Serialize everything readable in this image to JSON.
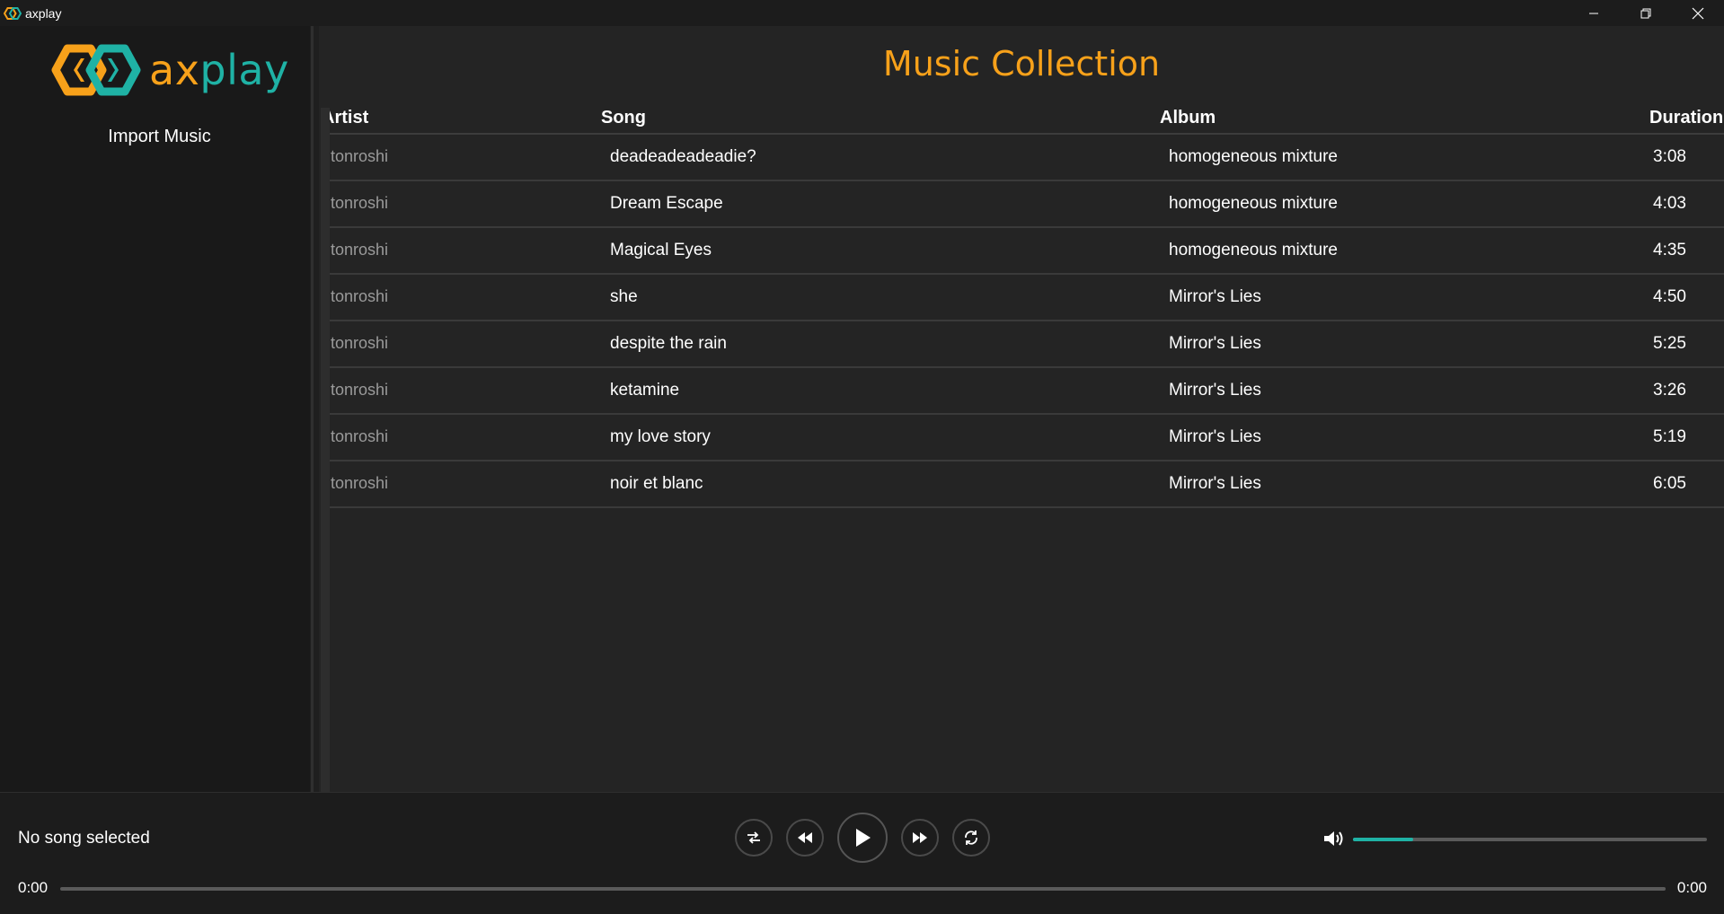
{
  "window": {
    "title": "axplay",
    "controls": [
      "minimize-icon",
      "restore-icon",
      "close-icon"
    ]
  },
  "sidebar": {
    "logo": {
      "part1": "ax",
      "part2": "play"
    },
    "import_label": "Import Music"
  },
  "main": {
    "title": "Music Collection",
    "columns": {
      "artist": "Artist",
      "song": "Song",
      "album": "Album",
      "duration": "Duration"
    },
    "rows": [
      {
        "artist": "tonroshi",
        "song": "deadeadeadeadie?",
        "album": "homogeneous mixture",
        "duration": "3:08"
      },
      {
        "artist": "tonroshi",
        "song": "Dream Escape",
        "album": "homogeneous mixture",
        "duration": "4:03"
      },
      {
        "artist": "tonroshi",
        "song": "Magical Eyes",
        "album": "homogeneous mixture",
        "duration": "4:35"
      },
      {
        "artist": "tonroshi",
        "song": "she",
        "album": "Mirror's Lies",
        "duration": "4:50"
      },
      {
        "artist": "tonroshi",
        "song": "despite the rain",
        "album": "Mirror's Lies",
        "duration": "5:25"
      },
      {
        "artist": "tonroshi",
        "song": "ketamine",
        "album": "Mirror's Lies",
        "duration": "3:26"
      },
      {
        "artist": "tonroshi",
        "song": "my love story",
        "album": "Mirror's Lies",
        "duration": "5:19"
      },
      {
        "artist": "tonroshi",
        "song": "noir et blanc",
        "album": "Mirror's Lies",
        "duration": "6:05"
      }
    ]
  },
  "player": {
    "now_playing": "No song selected",
    "time_elapsed": "0:00",
    "time_total": "0:00",
    "seek_progress": 0,
    "volume_level": 0.17,
    "controls": [
      "shuffle-icon",
      "rewind-icon",
      "play-icon",
      "fast-forward-icon",
      "repeat-icon"
    ]
  },
  "colors": {
    "accent_orange": "#f7a11a",
    "accent_teal": "#1fb2a5",
    "background": "#242424",
    "sidebar": "#191919"
  }
}
